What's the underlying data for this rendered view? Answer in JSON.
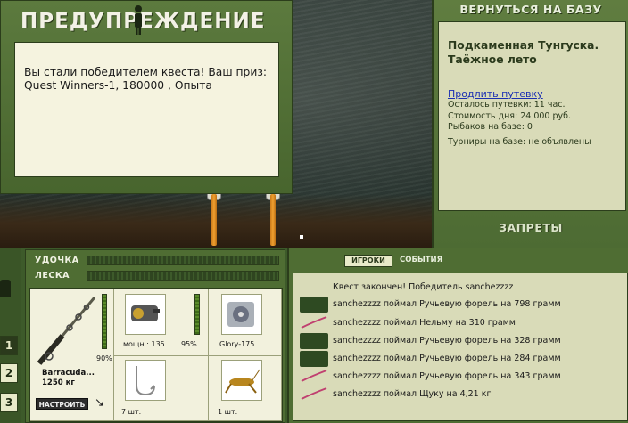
{
  "warning": {
    "title": "ПРЕДУПРЕЖДЕНИЕ",
    "message": "Вы стали победителем квеста! Ваш приз: Quest Winners-1, 180000 , Опыта"
  },
  "base": {
    "return_label": "ВЕРНУТЬСЯ НА БАЗУ",
    "name": "Подкаменная Тунгуска. Таёжное лето",
    "extend_link": "Продлить путевку",
    "trip_left": "Осталось путевки: 11 час.",
    "day_cost": "Стоимость дня: 24 000 руб.",
    "fishers": "Рыбаков на базе: 0",
    "tournaments": "Турниры на базе: не объявлены",
    "bans_label": "ЗАПРЕТЫ"
  },
  "slots": [
    "1",
    "2",
    "3"
  ],
  "tackle": {
    "rod_label": "УДОЧКА",
    "line_label": "ЛЕСКА",
    "rod_percent": "90%",
    "rod_name": "Barracuda...",
    "rod_weight": "1250 кг",
    "setup_button": "НАСТРОИТЬ",
    "reel_caption": "мощн.: 135",
    "reel_percent": "95%",
    "line_caption": "Glory-175...",
    "hook_caption": "7 шт.",
    "bait_caption": "1 шт."
  },
  "events": {
    "tab_players": "ИГРОКИ",
    "tab_events": "СОБЫТИЯ",
    "items": [
      "Квест закончен! Победитель sanchezzzz",
      "sanchezzzz поймал Ручьевую форель на 798 грамм",
      "sanchezzzz поймал Нельму на 310 грамм",
      "sanchezzzz поймал Ручьевую форель на 328 грамм",
      "sanchezzzz поймал Ручьевую форель на 284 грамм",
      "sanchezzzz поймал Ручьевую форель на 343 грамм",
      "sanchezzzz поймал Щуку на 4,21 кг"
    ]
  }
}
